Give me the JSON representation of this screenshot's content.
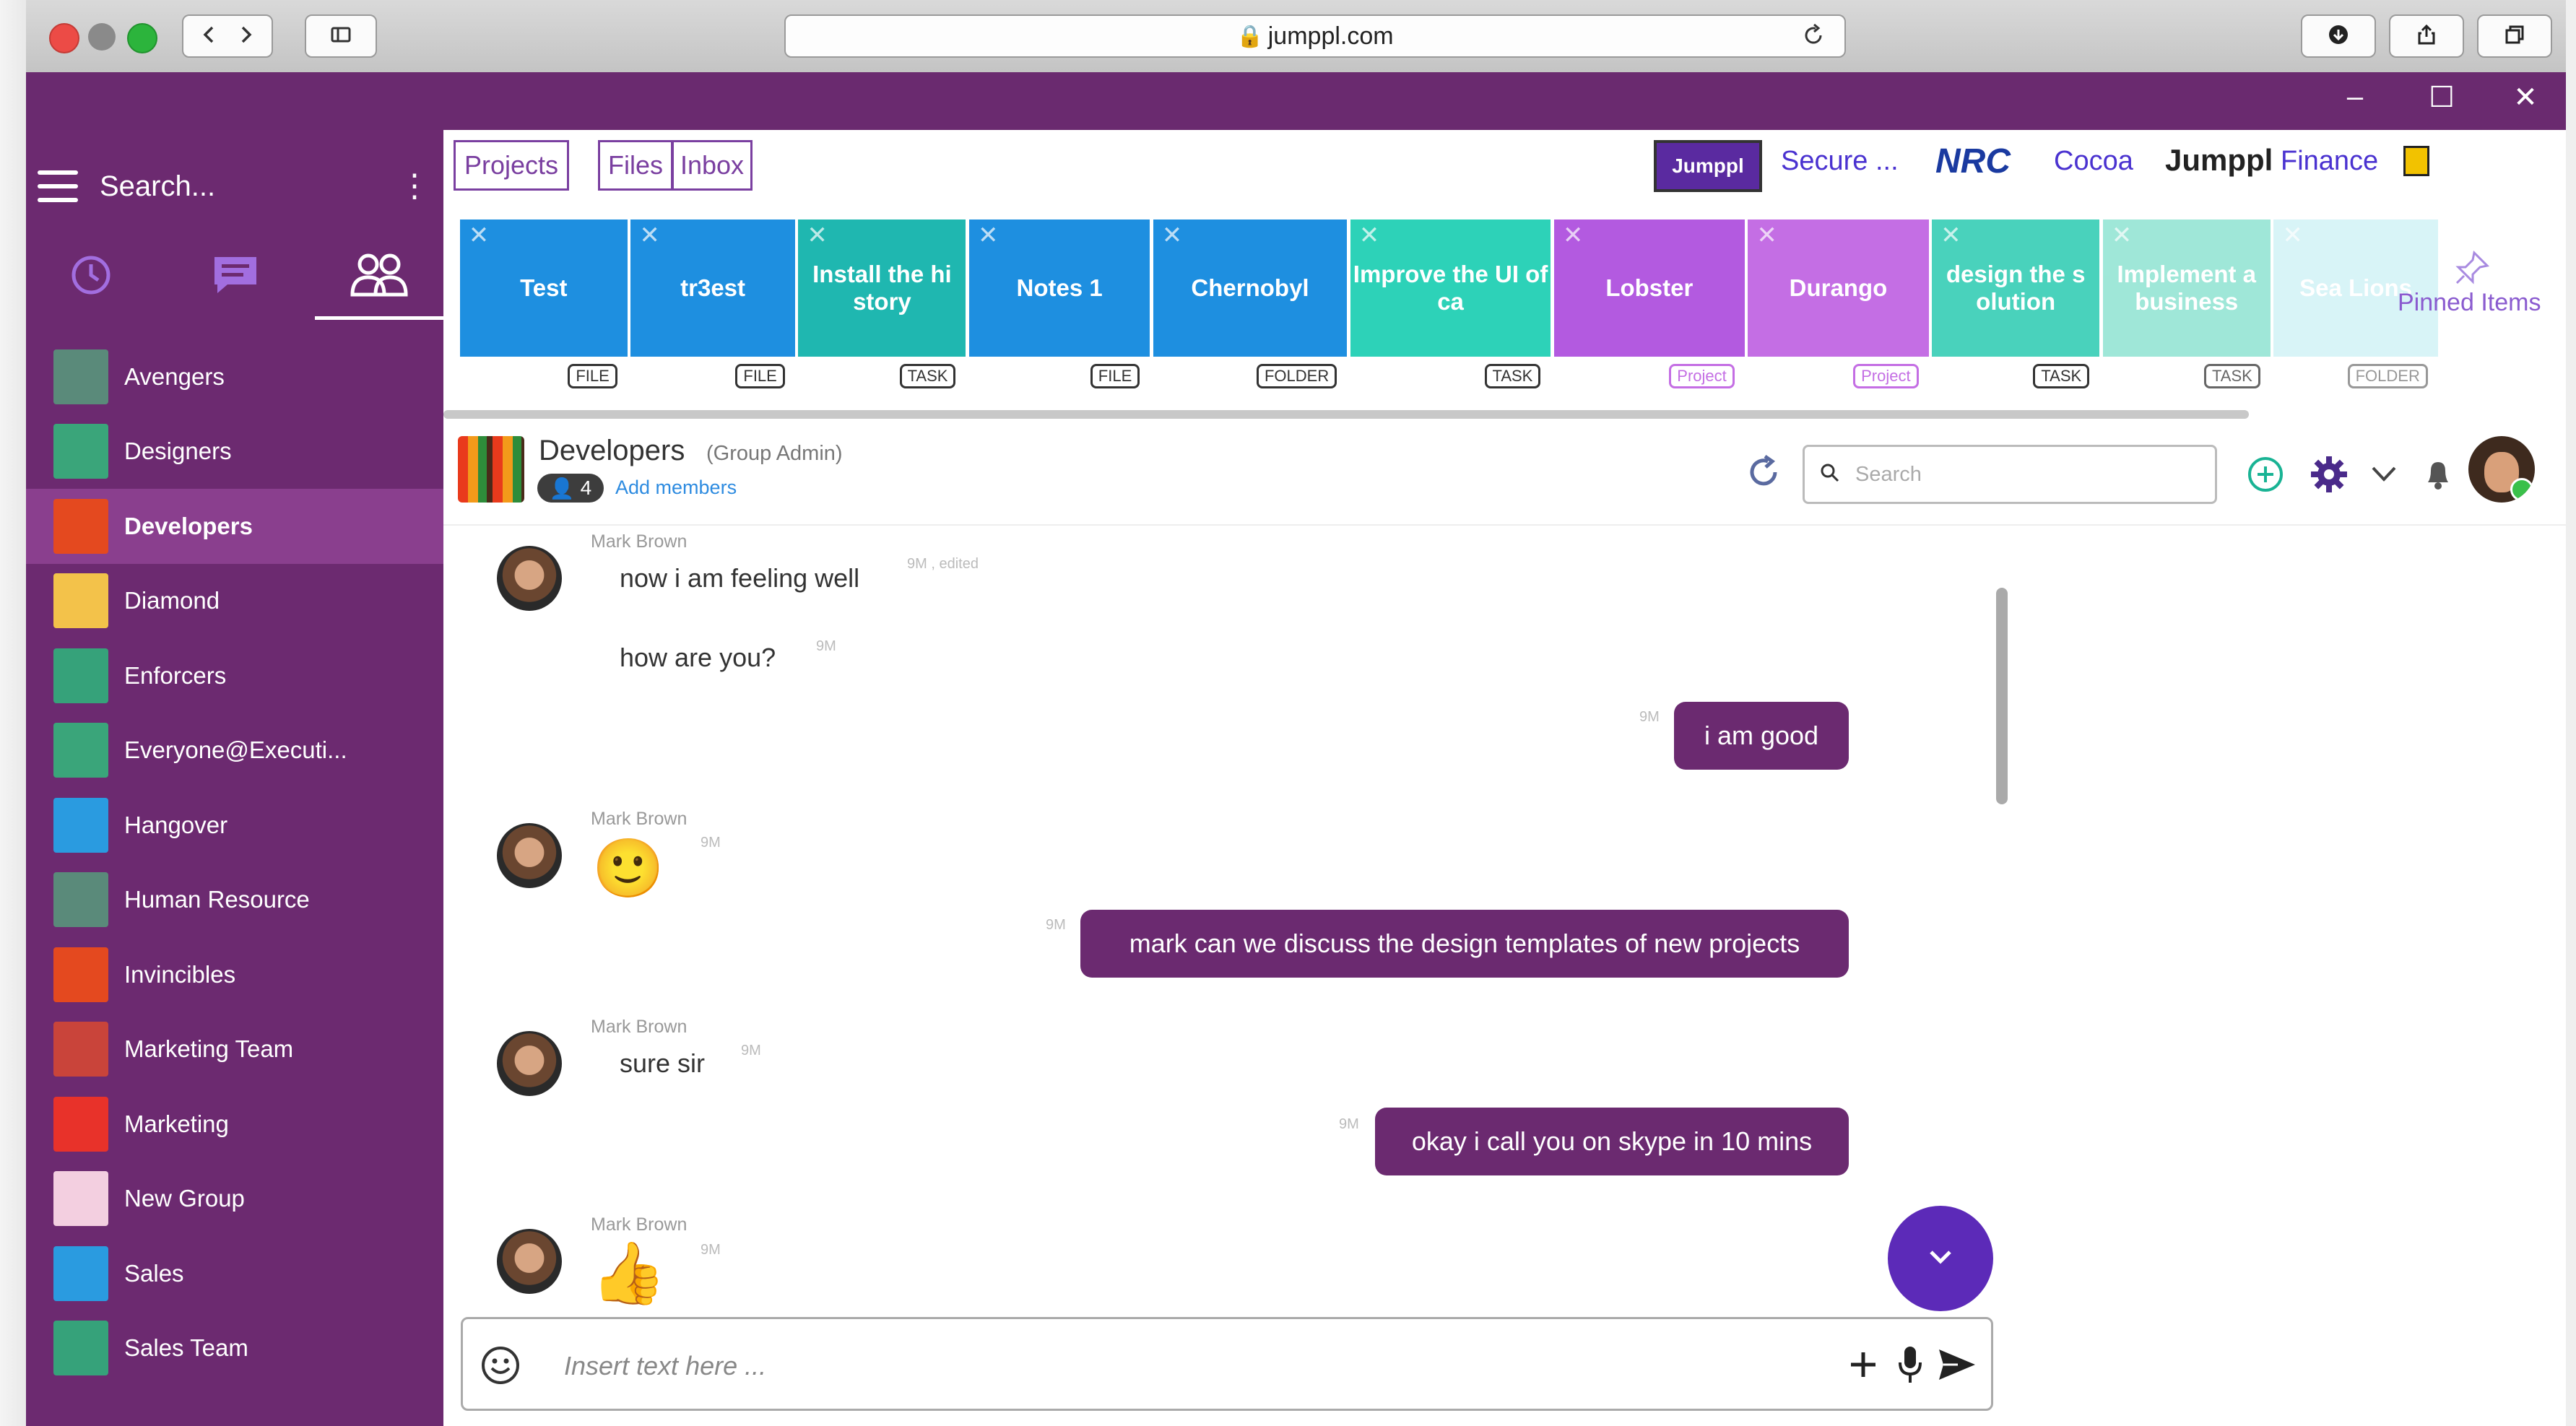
{
  "browser": {
    "url": "jumppl.com"
  },
  "sidebar": {
    "search_placeholder": "Search...",
    "groups": [
      {
        "name": "Avengers",
        "avatar_color": "#5a8a7a"
      },
      {
        "name": "Designers",
        "avatar_color": "#3aa57a"
      },
      {
        "name": "Developers",
        "avatar_color": "#e4491f",
        "active": true
      },
      {
        "name": "Diamond",
        "avatar_color": "#f3c24a"
      },
      {
        "name": "Enforcers",
        "avatar_color": "#36a27a"
      },
      {
        "name": "Everyone@Executi...",
        "avatar_color": "#3aa57a"
      },
      {
        "name": "Hangover",
        "avatar_color": "#2a9be0"
      },
      {
        "name": "Human Resource",
        "avatar_color": "#5a8a7a"
      },
      {
        "name": "Invincibles",
        "avatar_color": "#e4491f"
      },
      {
        "name": "Marketing Team",
        "avatar_color": "#c9443a"
      },
      {
        "name": "Marketing",
        "avatar_color": "#e8322a"
      },
      {
        "name": "New Group",
        "avatar_color": "#f3cfe0"
      },
      {
        "name": "Sales",
        "avatar_color": "#2a9be0"
      },
      {
        "name": "Sales Team",
        "avatar_color": "#36a27a"
      }
    ]
  },
  "nav": {
    "projects": "Projects",
    "files": "Files",
    "inbox": "Inbox"
  },
  "workspaces": {
    "jumppl_logo": "Jumppl",
    "secure": "Secure ...",
    "nrc": "NRC",
    "cocoa": "Cocoa",
    "jumppl": "Jumppl",
    "finance": "Finance"
  },
  "pinned": {
    "label": "Pinned Items",
    "tiles": [
      {
        "title": "Test",
        "tag": "FILE",
        "color": "#1e8fe0"
      },
      {
        "title": "tr3est",
        "tag": "FILE",
        "color": "#1e8fe0"
      },
      {
        "title": "Install the hi story",
        "tag": "TASK",
        "color": "#1fb7b0"
      },
      {
        "title": "Notes 1",
        "tag": "FILE",
        "color": "#1e8fe0"
      },
      {
        "title": "Chernobyl",
        "tag": "FOLDER",
        "color": "#1e8fe0"
      },
      {
        "title": "Improve the UI of ca",
        "tag": "TASK",
        "color": "#2dd2b8"
      },
      {
        "title": "Lobster",
        "tag": "Project",
        "color": "#b35ae0"
      },
      {
        "title": "Durango",
        "tag": "Project",
        "color": "#c46ee4"
      },
      {
        "title": "design the s olution",
        "tag": "TASK",
        "color": "#49d2bc"
      },
      {
        "title": "Implement a business",
        "tag": "TASK",
        "color": "#7fe0cc"
      },
      {
        "title": "Sea Lions",
        "tag": "FOLDER",
        "color": "#b3eaf0"
      }
    ]
  },
  "chat": {
    "group_name": "Developers",
    "role": "(Group Admin)",
    "member_count": "4",
    "add_members": "Add members",
    "search_placeholder": "Search",
    "messages": [
      {
        "sender": "Mark Brown",
        "text": "now i am feeling well",
        "time": "9M , edited",
        "dir": "in"
      },
      {
        "text": "how are you?",
        "time": "9M",
        "dir": "in"
      },
      {
        "text": "i am good",
        "time": "9M",
        "dir": "out"
      },
      {
        "sender": "Mark Brown",
        "emoji": "🙂",
        "time": "9M",
        "dir": "in"
      },
      {
        "text": "mark can we discuss the design templates of new projects",
        "time": "9M",
        "dir": "out"
      },
      {
        "sender": "Mark Brown",
        "text": "sure sir",
        "time": "9M",
        "dir": "in"
      },
      {
        "text": "okay i call you on skype in 10 mins",
        "time": "9M",
        "dir": "out"
      },
      {
        "sender": "Mark Brown",
        "emoji": "👍",
        "time": "9M",
        "dir": "in"
      }
    ],
    "composer_placeholder": "Insert text here ..."
  },
  "colors": {
    "sidebar": "#6c2a70",
    "accent": "#5c2ab8",
    "bubble": "#6b2a70"
  }
}
